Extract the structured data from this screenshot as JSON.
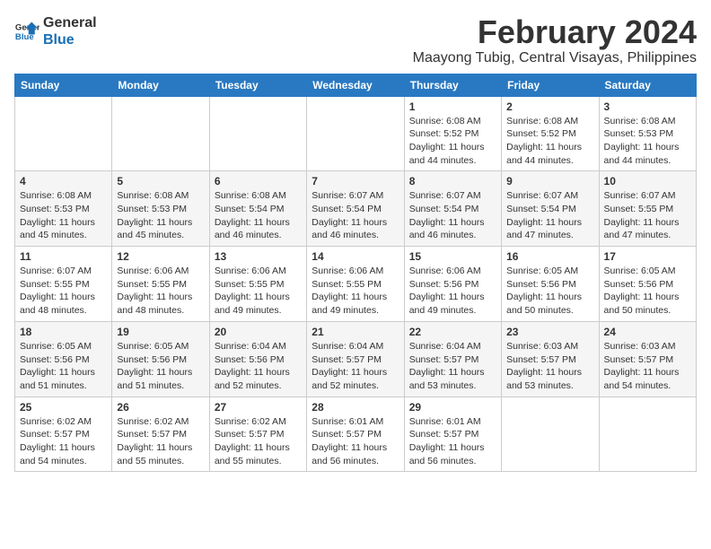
{
  "header": {
    "logo_line1": "General",
    "logo_line2": "Blue",
    "month_title": "February 2024",
    "location": "Maayong Tubig, Central Visayas, Philippines"
  },
  "days_of_week": [
    "Sunday",
    "Monday",
    "Tuesday",
    "Wednesday",
    "Thursday",
    "Friday",
    "Saturday"
  ],
  "weeks": [
    [
      {
        "day": "",
        "info": ""
      },
      {
        "day": "",
        "info": ""
      },
      {
        "day": "",
        "info": ""
      },
      {
        "day": "",
        "info": ""
      },
      {
        "day": "1",
        "info": "Sunrise: 6:08 AM\nSunset: 5:52 PM\nDaylight: 11 hours and 44 minutes."
      },
      {
        "day": "2",
        "info": "Sunrise: 6:08 AM\nSunset: 5:52 PM\nDaylight: 11 hours and 44 minutes."
      },
      {
        "day": "3",
        "info": "Sunrise: 6:08 AM\nSunset: 5:53 PM\nDaylight: 11 hours and 44 minutes."
      }
    ],
    [
      {
        "day": "4",
        "info": "Sunrise: 6:08 AM\nSunset: 5:53 PM\nDaylight: 11 hours and 45 minutes."
      },
      {
        "day": "5",
        "info": "Sunrise: 6:08 AM\nSunset: 5:53 PM\nDaylight: 11 hours and 45 minutes."
      },
      {
        "day": "6",
        "info": "Sunrise: 6:08 AM\nSunset: 5:54 PM\nDaylight: 11 hours and 46 minutes."
      },
      {
        "day": "7",
        "info": "Sunrise: 6:07 AM\nSunset: 5:54 PM\nDaylight: 11 hours and 46 minutes."
      },
      {
        "day": "8",
        "info": "Sunrise: 6:07 AM\nSunset: 5:54 PM\nDaylight: 11 hours and 46 minutes."
      },
      {
        "day": "9",
        "info": "Sunrise: 6:07 AM\nSunset: 5:54 PM\nDaylight: 11 hours and 47 minutes."
      },
      {
        "day": "10",
        "info": "Sunrise: 6:07 AM\nSunset: 5:55 PM\nDaylight: 11 hours and 47 minutes."
      }
    ],
    [
      {
        "day": "11",
        "info": "Sunrise: 6:07 AM\nSunset: 5:55 PM\nDaylight: 11 hours and 48 minutes."
      },
      {
        "day": "12",
        "info": "Sunrise: 6:06 AM\nSunset: 5:55 PM\nDaylight: 11 hours and 48 minutes."
      },
      {
        "day": "13",
        "info": "Sunrise: 6:06 AM\nSunset: 5:55 PM\nDaylight: 11 hours and 49 minutes."
      },
      {
        "day": "14",
        "info": "Sunrise: 6:06 AM\nSunset: 5:55 PM\nDaylight: 11 hours and 49 minutes."
      },
      {
        "day": "15",
        "info": "Sunrise: 6:06 AM\nSunset: 5:56 PM\nDaylight: 11 hours and 49 minutes."
      },
      {
        "day": "16",
        "info": "Sunrise: 6:05 AM\nSunset: 5:56 PM\nDaylight: 11 hours and 50 minutes."
      },
      {
        "day": "17",
        "info": "Sunrise: 6:05 AM\nSunset: 5:56 PM\nDaylight: 11 hours and 50 minutes."
      }
    ],
    [
      {
        "day": "18",
        "info": "Sunrise: 6:05 AM\nSunset: 5:56 PM\nDaylight: 11 hours and 51 minutes."
      },
      {
        "day": "19",
        "info": "Sunrise: 6:05 AM\nSunset: 5:56 PM\nDaylight: 11 hours and 51 minutes."
      },
      {
        "day": "20",
        "info": "Sunrise: 6:04 AM\nSunset: 5:56 PM\nDaylight: 11 hours and 52 minutes."
      },
      {
        "day": "21",
        "info": "Sunrise: 6:04 AM\nSunset: 5:57 PM\nDaylight: 11 hours and 52 minutes."
      },
      {
        "day": "22",
        "info": "Sunrise: 6:04 AM\nSunset: 5:57 PM\nDaylight: 11 hours and 53 minutes."
      },
      {
        "day": "23",
        "info": "Sunrise: 6:03 AM\nSunset: 5:57 PM\nDaylight: 11 hours and 53 minutes."
      },
      {
        "day": "24",
        "info": "Sunrise: 6:03 AM\nSunset: 5:57 PM\nDaylight: 11 hours and 54 minutes."
      }
    ],
    [
      {
        "day": "25",
        "info": "Sunrise: 6:02 AM\nSunset: 5:57 PM\nDaylight: 11 hours and 54 minutes."
      },
      {
        "day": "26",
        "info": "Sunrise: 6:02 AM\nSunset: 5:57 PM\nDaylight: 11 hours and 55 minutes."
      },
      {
        "day": "27",
        "info": "Sunrise: 6:02 AM\nSunset: 5:57 PM\nDaylight: 11 hours and 55 minutes."
      },
      {
        "day": "28",
        "info": "Sunrise: 6:01 AM\nSunset: 5:57 PM\nDaylight: 11 hours and 56 minutes."
      },
      {
        "day": "29",
        "info": "Sunrise: 6:01 AM\nSunset: 5:57 PM\nDaylight: 11 hours and 56 minutes."
      },
      {
        "day": "",
        "info": ""
      },
      {
        "day": "",
        "info": ""
      }
    ]
  ]
}
